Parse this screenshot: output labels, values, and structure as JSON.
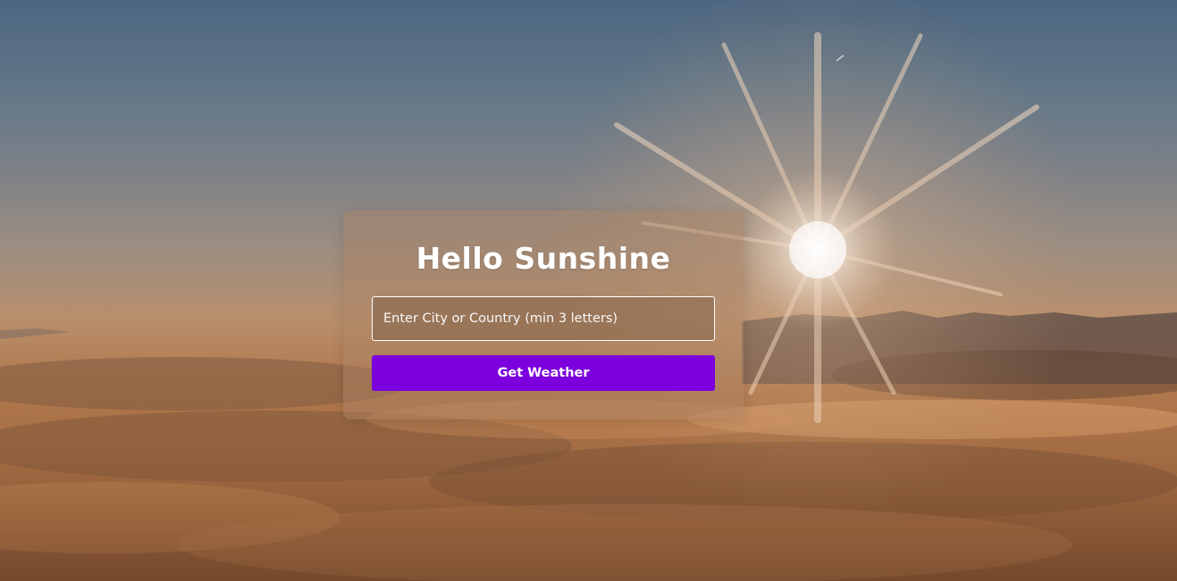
{
  "app": {
    "heading": "Hello Sunshine"
  },
  "search": {
    "placeholder": "Enter City or Country (min 3 letters)",
    "value": ""
  },
  "actions": {
    "get_weather_label": "Get Weather"
  },
  "colors": {
    "button_bg": "#7b00dd",
    "text": "#ffffff",
    "sky_top": "#4d6680",
    "clouds": "#b0784c"
  },
  "background": {
    "scene": "sunrise over clouds"
  }
}
